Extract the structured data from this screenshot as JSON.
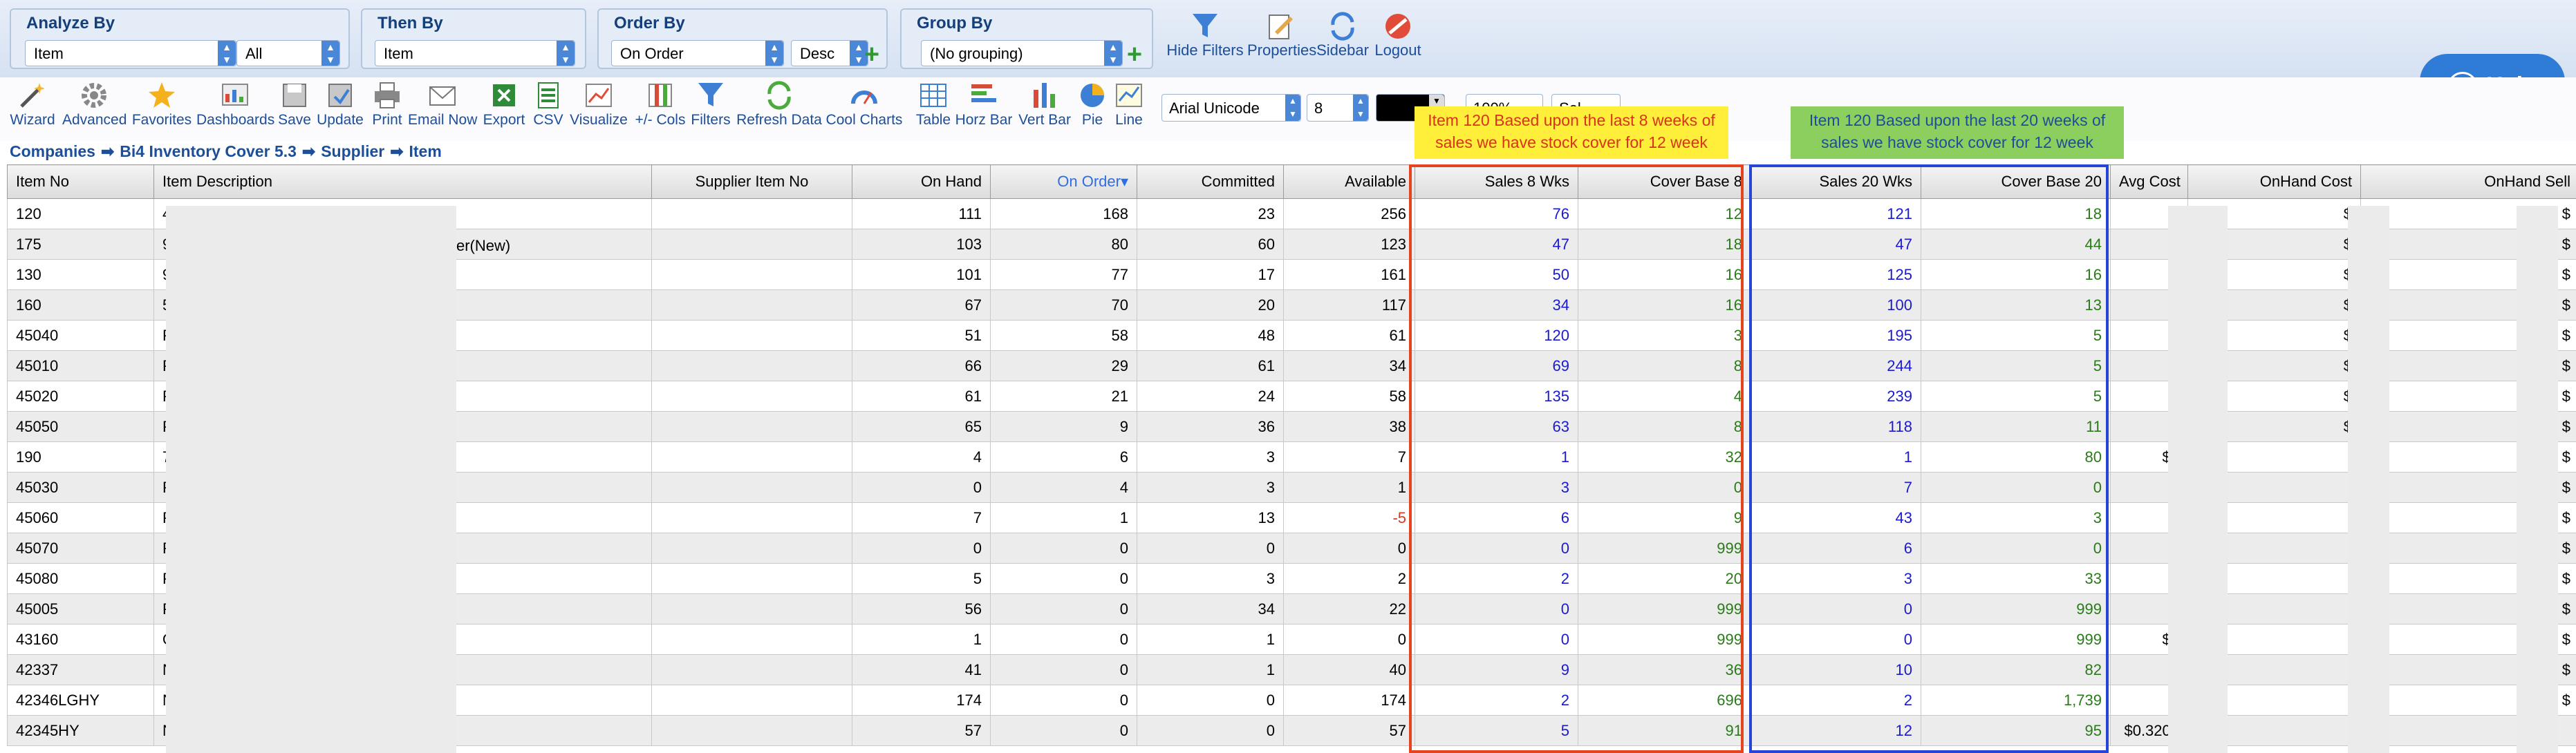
{
  "filters": {
    "analyze_by": {
      "title": "Analyze By",
      "value": "Item",
      "value2": "All"
    },
    "then_by": {
      "title": "Then By",
      "value": "Item"
    },
    "order_by": {
      "title": "Order By",
      "value": "On Order",
      "direction": "Desc"
    },
    "group_by": {
      "title": "Group By",
      "value": "(No grouping)"
    }
  },
  "top_buttons": {
    "hide_filters": "Hide Filters",
    "properties": "Properties",
    "sidebar": "Sidebar",
    "logout": "Logout",
    "help": "Help"
  },
  "toolbar": {
    "wizard": "Wizard",
    "advanced": "Advanced",
    "favorites": "Favorites",
    "dashboards": "Dashboards",
    "save": "Save",
    "update": "Update",
    "print": "Print",
    "email_now": "Email Now",
    "export": "Export",
    "csv": "CSV",
    "visualize": "Visualize",
    "cols": "+/- Cols",
    "filters": "Filters",
    "refresh_data": "Refresh Data",
    "cool_charts": "Cool Charts",
    "table": "Table",
    "horz_bar": "Horz Bar",
    "vert_bar": "Vert Bar",
    "pie": "Pie",
    "line": "Line",
    "font": "Arial Unicode",
    "font_size": "8",
    "zoom": "100%",
    "sel": "Sel"
  },
  "breadcrumb": [
    "Companies",
    "Bi4 Inventory Cover 5.3",
    "Supplier",
    "Item"
  ],
  "annotations": {
    "note_8": "Item 120 Based upon the last 8 weeks of sales we have stock cover for 12 week",
    "note_20": "Item 120 Based upon the last 20 weeks of sales we have stock cover for 12 week"
  },
  "columns": [
    "Item No",
    "Item Description",
    "Supplier Item No",
    "On Hand",
    "On Order",
    "Committed",
    "Available",
    "Sales 8 Wks",
    "Cover Base 8",
    "Sales 20 Wks",
    "Cover Base 20",
    "Avg Cost",
    "OnHand Cost",
    "OnHand Sell"
  ],
  "rows": [
    [
      "120",
      "4.",
      "",
      "111",
      "168",
      "23",
      "256",
      "76",
      "12",
      "121",
      "18",
      "$",
      "$",
      "$"
    ],
    [
      "175",
      "9.",
      "",
      "103",
      "80",
      "60",
      "123",
      "47",
      "18",
      "47",
      "44",
      "$",
      "$",
      "$"
    ],
    [
      "130",
      "9.",
      "",
      "101",
      "77",
      "17",
      "161",
      "50",
      "16",
      "125",
      "16",
      "$",
      "$",
      "$"
    ],
    [
      "160",
      "5.",
      "",
      "67",
      "70",
      "20",
      "117",
      "34",
      "16",
      "100",
      "13",
      "$",
      "$",
      "$"
    ],
    [
      "45040",
      "P",
      "",
      "51",
      "58",
      "48",
      "61",
      "120",
      "3",
      "195",
      "5",
      "$",
      "$",
      "$"
    ],
    [
      "45010",
      "P",
      "",
      "66",
      "29",
      "61",
      "34",
      "69",
      "8",
      "244",
      "5",
      "$",
      "$",
      "$"
    ],
    [
      "45020",
      "P",
      "",
      "61",
      "21",
      "24",
      "58",
      "135",
      "4",
      "239",
      "5",
      "$",
      "$",
      "$"
    ],
    [
      "45050",
      "P",
      "",
      "65",
      "9",
      "36",
      "38",
      "63",
      "8",
      "118",
      "11",
      "$",
      "$",
      "$"
    ],
    [
      "190",
      "7.",
      "",
      "4",
      "6",
      "3",
      "7",
      "1",
      "32",
      "1",
      "80",
      "$1",
      "",
      "$"
    ],
    [
      "45030",
      "P",
      "",
      "0",
      "4",
      "3",
      "1",
      "3",
      "0",
      "7",
      "0",
      "$",
      "",
      "$"
    ],
    [
      "45060",
      "P",
      "",
      "7",
      "1",
      "13",
      "-5",
      "6",
      "9",
      "43",
      "3",
      "$",
      "",
      "$"
    ],
    [
      "45070",
      "P",
      "",
      "0",
      "0",
      "0",
      "0",
      "0",
      "999",
      "6",
      "0",
      "$",
      "",
      "$"
    ],
    [
      "45080",
      "P",
      "",
      "5",
      "0",
      "3",
      "2",
      "2",
      "20",
      "3",
      "33",
      "$",
      "",
      "$"
    ],
    [
      "45005",
      "P",
      "",
      "56",
      "0",
      "34",
      "22",
      "0",
      "999",
      "0",
      "999",
      "$",
      "",
      "$"
    ],
    [
      "43160",
      "O",
      "",
      "1",
      "0",
      "1",
      "0",
      "0",
      "999",
      "0",
      "999",
      "$1",
      "",
      "$"
    ],
    [
      "42337",
      "N",
      "",
      "41",
      "0",
      "1",
      "40",
      "9",
      "36",
      "10",
      "82",
      "$",
      "",
      "$"
    ],
    [
      "42346LGHY",
      "N",
      "",
      "174",
      "0",
      "0",
      "174",
      "2",
      "696",
      "2",
      "1,739",
      "$",
      "",
      "$"
    ],
    [
      "42345HY",
      "N",
      "",
      "57",
      "0",
      "0",
      "57",
      "5",
      "91",
      "12",
      "95",
      "$0.3200",
      "",
      ""
    ]
  ],
  "desc_fragment_row2": "er(New)",
  "colors": {
    "sales_red_box": "#e4441e",
    "sales_blue_box": "#2545d6",
    "note_yellow": "#ffef3a",
    "note_green": "#8ccf5e"
  }
}
